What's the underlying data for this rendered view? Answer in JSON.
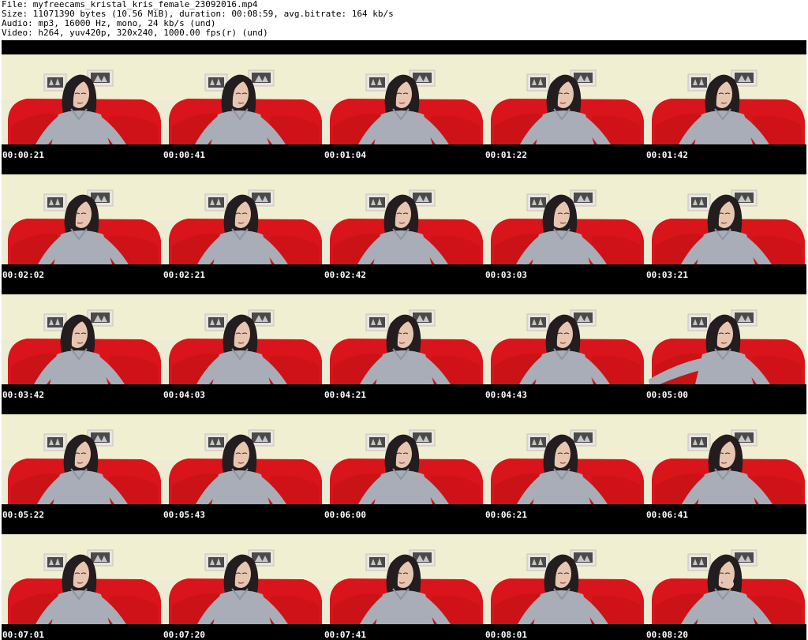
{
  "header": {
    "file_line": "File: myfreecams_kristal_kris_female_23092016.mp4",
    "size_line": "Size: 11071390 bytes (10.56 MiB), duration: 00:08:59, avg.bitrate: 164 kb/s",
    "audio_line": "Audio: mp3, 16000 Hz, mono, 24 kb/s (und)",
    "video_line": "Video: h264, yuv420p, 320x240, 1000.00 fps(r) (und)"
  },
  "thumbnails": [
    {
      "time": "00:00:21"
    },
    {
      "time": "00:00:41"
    },
    {
      "time": "00:01:04"
    },
    {
      "time": "00:01:22"
    },
    {
      "time": "00:01:42"
    },
    {
      "time": "00:02:02"
    },
    {
      "time": "00:02:21"
    },
    {
      "time": "00:02:42"
    },
    {
      "time": "00:03:03"
    },
    {
      "time": "00:03:21"
    },
    {
      "time": "00:03:42"
    },
    {
      "time": "00:04:03"
    },
    {
      "time": "00:04:21"
    },
    {
      "time": "00:04:43"
    },
    {
      "time": "00:05:00"
    },
    {
      "time": "00:05:22"
    },
    {
      "time": "00:05:43"
    },
    {
      "time": "00:06:00"
    },
    {
      "time": "00:06:21"
    },
    {
      "time": "00:06:41"
    },
    {
      "time": "00:07:01"
    },
    {
      "time": "00:07:20"
    },
    {
      "time": "00:07:41"
    },
    {
      "time": "00:08:01"
    },
    {
      "time": "00:08:20"
    }
  ],
  "colors": {
    "sheet_background": "#000000",
    "wall": "#f1efd1",
    "sofa_red": "#d9141b",
    "shirt_gray": "#a8adb8",
    "hair_dark": "#231d1f",
    "skin": "#e7c6b1",
    "picture_frame": "#e8e4df",
    "picture_dark": "#4a4a4a",
    "timestamp_text": "#ffffff"
  }
}
